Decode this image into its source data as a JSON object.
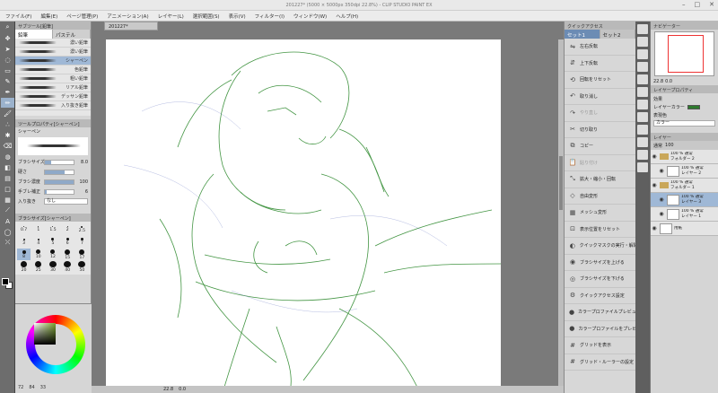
{
  "window": {
    "title": "201227* (5000 × 5000px 350dpi 22.8%) - CLIP STUDIO PAINT EX",
    "controls": [
      "–",
      "□",
      "✕"
    ]
  },
  "menu": [
    "ファイル(F)",
    "編集(E)",
    "ページ管理(P)",
    "アニメーション(A)",
    "レイヤー(L)",
    "選択範囲(S)",
    "表示(V)",
    "フィルター(I)",
    "ウィンドウ(W)",
    "ヘルプ(H)"
  ],
  "tools": [
    {
      "icon": "zoom-icon",
      "glyph": "⌕"
    },
    {
      "icon": "move-icon",
      "glyph": "✥"
    },
    {
      "icon": "operation-icon",
      "glyph": "➤"
    },
    {
      "icon": "lasso-icon",
      "glyph": "◌"
    },
    {
      "icon": "selection-icon",
      "glyph": "▭"
    },
    {
      "icon": "eyedropper-icon",
      "glyph": "✎"
    },
    {
      "icon": "pen-icon",
      "glyph": "✒"
    },
    {
      "icon": "pencil-icon",
      "glyph": "✏"
    },
    {
      "icon": "brush-icon",
      "glyph": "🖌"
    },
    {
      "icon": "airbrush-icon",
      "glyph": "∴"
    },
    {
      "icon": "decoration-icon",
      "glyph": "✱"
    },
    {
      "icon": "eraser-icon",
      "glyph": "⌫"
    },
    {
      "icon": "blend-icon",
      "glyph": "◍"
    },
    {
      "icon": "fill-icon",
      "glyph": "◧"
    },
    {
      "icon": "gradient-icon",
      "glyph": "▤"
    },
    {
      "icon": "figure-icon",
      "glyph": "□"
    },
    {
      "icon": "frame-icon",
      "glyph": "▦"
    },
    {
      "icon": "ruler-icon",
      "glyph": "⟋"
    },
    {
      "icon": "text-icon",
      "glyph": "A"
    },
    {
      "icon": "balloon-icon",
      "glyph": "◯"
    },
    {
      "icon": "correction-icon",
      "glyph": "⤫"
    }
  ],
  "subtool": {
    "header": "サブツール[鉛筆]",
    "tabs": [
      "鉛筆",
      "パステル"
    ],
    "brushes": [
      {
        "name": "濃い鉛筆",
        "selected": false
      },
      {
        "name": "濃い鉛筆",
        "selected": false
      },
      {
        "name": "シャーペン",
        "selected": true
      },
      {
        "name": "色鉛筆",
        "selected": false
      },
      {
        "name": "粗い鉛筆",
        "selected": false
      },
      {
        "name": "リアル鉛筆",
        "selected": false
      },
      {
        "name": "デッサン鉛筆",
        "selected": false
      },
      {
        "name": "入り抜き鉛筆",
        "selected": false
      }
    ]
  },
  "tool_property": {
    "header": "ツールプロパティ[シャーペン]",
    "brush_label": "シャーペン",
    "rows": [
      {
        "label": "ブラシサイズ",
        "value": "8.0",
        "fill": 0.22
      },
      {
        "label": "硬さ",
        "value": "",
        "fill": 0.7
      },
      {
        "label": "ブラシ濃度",
        "value": "100",
        "fill": 1.0
      },
      {
        "label": "手ブレ補正",
        "value": "6",
        "fill": 0.06
      }
    ],
    "stroke_in_out_label": "入り抜き",
    "stroke_in_out_value": "なし"
  },
  "brush_size": {
    "header": "ブラシサイズ[シャーペン]",
    "sizes": [
      {
        "label": "0.7",
        "d": 1
      },
      {
        "label": "1",
        "d": 1
      },
      {
        "label": "1.5",
        "d": 1
      },
      {
        "label": "2",
        "d": 1
      },
      {
        "label": "2.5",
        "d": 2
      },
      {
        "label": "3",
        "d": 2
      },
      {
        "label": "4",
        "d": 2
      },
      {
        "label": "5",
        "d": 3
      },
      {
        "label": "6",
        "d": 3
      },
      {
        "label": "7",
        "d": 3
      },
      {
        "label": "8",
        "d": 4
      },
      {
        "label": "10",
        "d": 5
      },
      {
        "label": "12",
        "d": 5
      },
      {
        "label": "15",
        "d": 6
      },
      {
        "label": "17",
        "d": 6
      },
      {
        "label": "20",
        "d": 7
      },
      {
        "label": "25",
        "d": 7
      },
      {
        "label": "30",
        "d": 8
      },
      {
        "label": "40",
        "d": 8
      },
      {
        "label": "50",
        "d": 8
      }
    ],
    "selected_index": 10
  },
  "color": {
    "status": [
      "72",
      "84",
      "33"
    ],
    "main": "#000000",
    "sub": "#ffffff"
  },
  "canvas": {
    "doc_tab": "201227*",
    "zoom_label": "22.8",
    "angle_label": "0.0",
    "line_color": "#2f8a2f"
  },
  "quick_access": {
    "tabs": [
      "セット1",
      "セット2"
    ],
    "items": [
      {
        "icon": "flip-h-icon",
        "glyph": "⇋",
        "label": "左右反転",
        "dim": false
      },
      {
        "icon": "flip-v-icon",
        "glyph": "⇵",
        "label": "上下反転",
        "dim": false
      },
      {
        "icon": "rotate-reset-icon",
        "glyph": "⟲",
        "label": "回転をリセット",
        "dim": false
      },
      {
        "icon": "undo-icon",
        "glyph": "↶",
        "label": "取り消し",
        "dim": false
      },
      {
        "icon": "redo-icon",
        "glyph": "↷",
        "label": "やり直し",
        "dim": true
      },
      {
        "icon": "cut-icon",
        "glyph": "✂",
        "label": "切り取り",
        "dim": false
      },
      {
        "icon": "copy-icon",
        "glyph": "⧉",
        "label": "コピー",
        "dim": false
      },
      {
        "icon": "paste-icon",
        "glyph": "📋",
        "label": "貼り付け",
        "dim": true
      },
      {
        "icon": "scale-icon",
        "glyph": "⤡",
        "label": "拡大・縮小・回転",
        "dim": false
      },
      {
        "icon": "free-transform-icon",
        "glyph": "◇",
        "label": "自由変形",
        "dim": false
      },
      {
        "icon": "mesh-icon",
        "glyph": "▦",
        "label": "メッシュ変形",
        "dim": false
      },
      {
        "icon": "reset-display-icon",
        "glyph": "⊡",
        "label": "表示位置をリセット",
        "dim": false
      },
      {
        "icon": "quick-mask-icon",
        "glyph": "◐",
        "label": "クイックマスクの実行・解除",
        "dim": false
      },
      {
        "icon": "brush-up-icon",
        "glyph": "◉",
        "label": "ブラシサイズを上げる",
        "dim": false
      },
      {
        "icon": "brush-down-icon",
        "glyph": "◎",
        "label": "ブラシサイズを下げる",
        "dim": false
      },
      {
        "icon": "quick-settings-icon",
        "glyph": "⚙",
        "label": "クイックアクセス設定",
        "dim": false
      },
      {
        "icon": "color-profile-icon",
        "glyph": "●",
        "label": "カラープロファイルプレビュー設定",
        "dim": false
      },
      {
        "icon": "color-preview-icon",
        "glyph": "●",
        "label": "カラープロファイルをプレビュー",
        "dim": false
      },
      {
        "icon": "grid-icon",
        "glyph": "#",
        "label": "グリッドを表示",
        "dim": false
      },
      {
        "icon": "grid-settings-icon",
        "glyph": "#",
        "label": "グリッド・ルーラーの設定",
        "dim": false
      }
    ]
  },
  "navigator": {
    "header": "ナビゲーター",
    "zoom": "22.8",
    "angle": "0.0"
  },
  "layer_property": {
    "header": "レイヤープロパティ",
    "effect_label": "効果",
    "layer_color_label": "レイヤーカラー",
    "layer_color": "#2d7a2d",
    "expression_label": "表現色",
    "expression_value": "カラー"
  },
  "layers": {
    "header": "レイヤー",
    "blend_mode": "通常",
    "opacity": "100",
    "rows": [
      {
        "kind": "folder",
        "indent": 0,
        "lines": [
          "100 % 通常",
          "フォルダー 2"
        ],
        "selected": false
      },
      {
        "kind": "layer",
        "indent": 1,
        "lines": [
          "100 % 通常",
          "レイヤー 2"
        ],
        "selected": false
      },
      {
        "kind": "folder",
        "indent": 0,
        "lines": [
          "100 % 通常",
          "フォルダー 1"
        ],
        "selected": false
      },
      {
        "kind": "layer",
        "indent": 1,
        "lines": [
          "100 % 通常",
          "レイヤー 3"
        ],
        "selected": true
      },
      {
        "kind": "layer",
        "indent": 1,
        "lines": [
          "100 % 通常",
          "レイヤー 1"
        ],
        "selected": false
      },
      {
        "kind": "paper",
        "indent": 0,
        "lines": [
          "",
          "用紙"
        ],
        "selected": false
      }
    ]
  }
}
